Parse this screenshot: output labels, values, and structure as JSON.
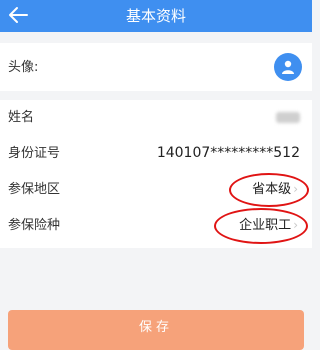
{
  "header": {
    "title": "基本资料",
    "back_icon": "arrow-left-icon"
  },
  "avatar_row": {
    "label": "头像:",
    "icon": "user-avatar-icon"
  },
  "fields": [
    {
      "label": "姓名",
      "value": ""
    },
    {
      "label": "身份证号",
      "value": "140107*********512"
    },
    {
      "label": "参保地区",
      "value": "省本级"
    },
    {
      "label": "参保险种",
      "value": "企业职工"
    }
  ],
  "save_button": {
    "label": "保存"
  },
  "colors": {
    "primary": "#3f8ff0",
    "save_button": "#f6a27a",
    "annotation_circle": "#e01414"
  }
}
